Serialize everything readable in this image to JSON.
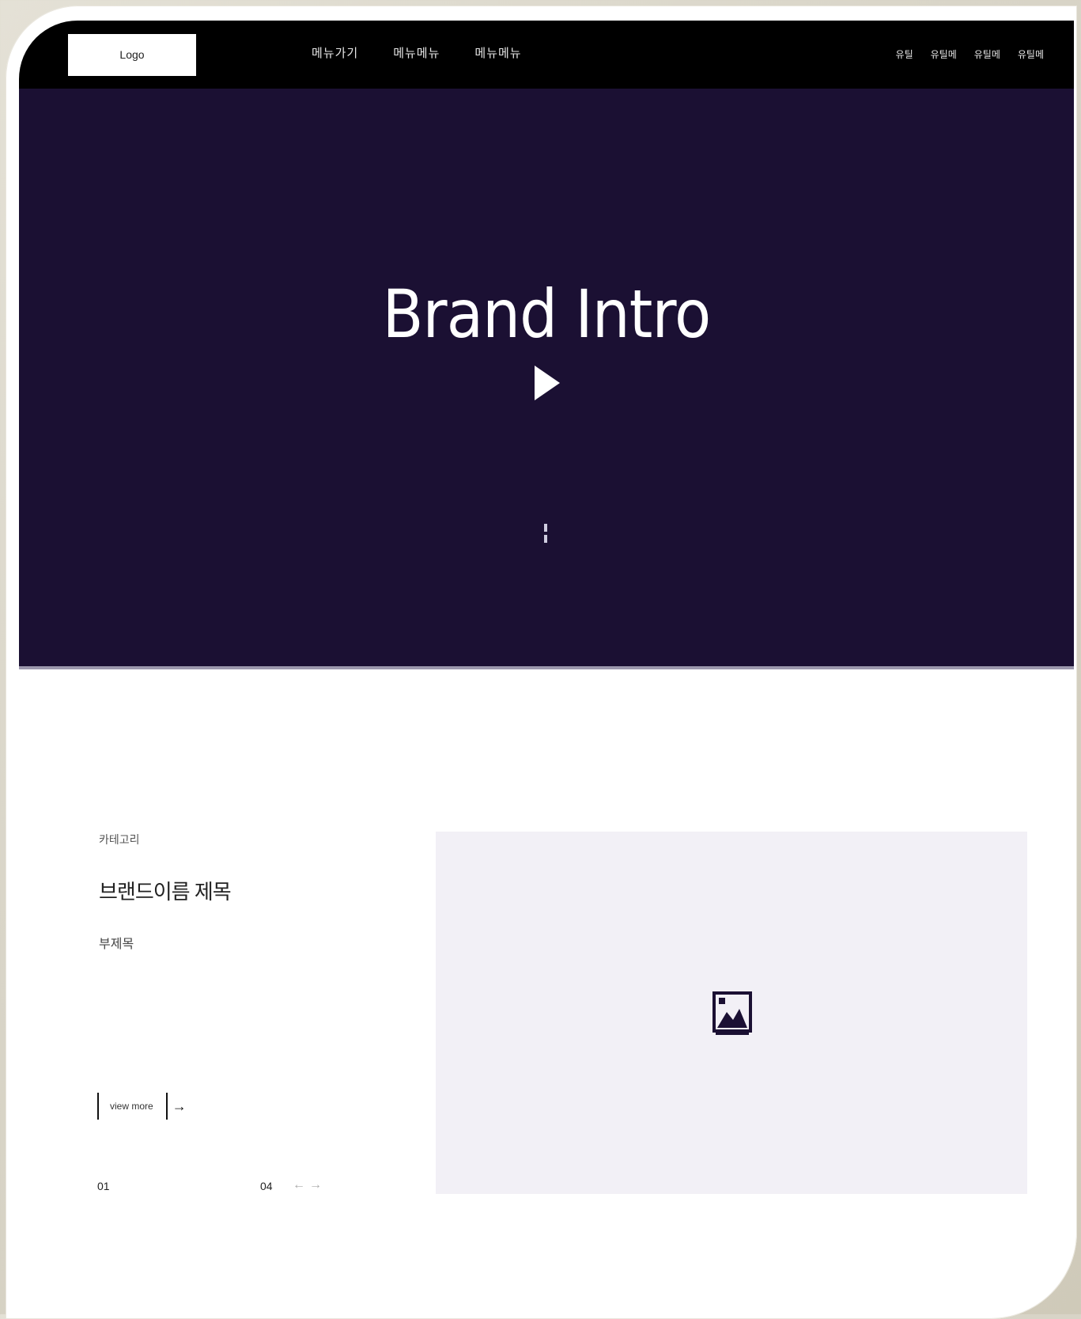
{
  "header": {
    "logo": "Logo",
    "nav": [
      "메뉴가기",
      "메뉴메뉴",
      "메뉴메뉴"
    ],
    "util": [
      "유틸",
      "유틸메",
      "유틸메",
      "유틸메"
    ]
  },
  "hero": {
    "title": "Brand Intro"
  },
  "item": {
    "category": "카테고리",
    "title": "브랜드이름 제목",
    "subtitle": "부제목",
    "view_more": "view more",
    "arrow": "→"
  },
  "pager": {
    "current": "01",
    "total": "04",
    "prev": "←",
    "next": "→"
  },
  "colors": {
    "header_bg": "#000000",
    "hero_bg": "#1b1033",
    "media_bg": "#f2f0f6"
  }
}
